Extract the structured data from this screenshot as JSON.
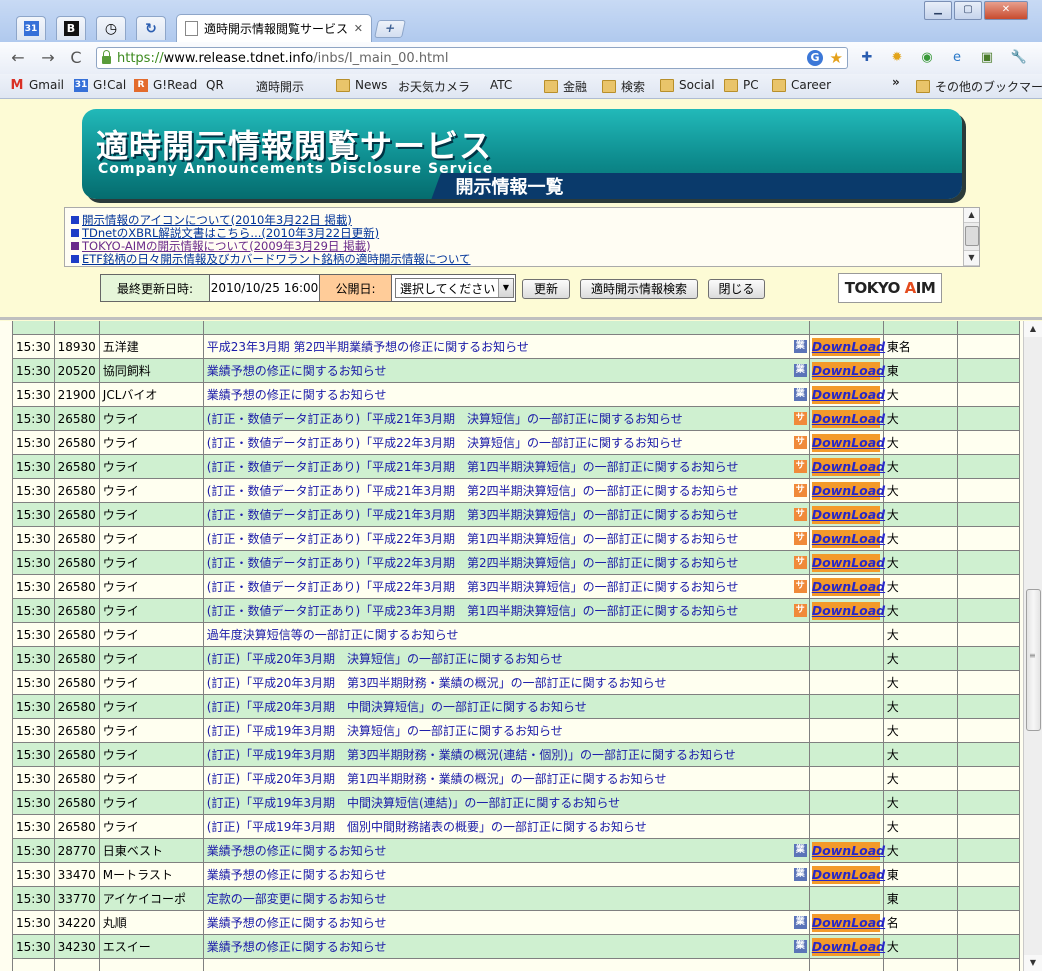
{
  "window": {
    "minimize": "▁",
    "maximize": "▢",
    "close": "✕"
  },
  "tabs": {
    "pinned": [
      {
        "icon": "calendar-icon",
        "glyph": "31"
      },
      {
        "icon": "bookmark-b-icon",
        "glyph": "B"
      },
      {
        "icon": "clock-icon",
        "glyph": "◷"
      },
      {
        "icon": "refresh-icon",
        "glyph": "↻"
      }
    ],
    "active_title": "適時開示情報閲覧サービス ...",
    "new_tab": "+"
  },
  "toolbar": {
    "url_proto": "https://",
    "url_host": "www.release.tdnet.info",
    "url_path": "/inbs/I_main_00.html"
  },
  "bookmarks": [
    {
      "label": "Gmail",
      "icon": "gmail"
    },
    {
      "label": "G!Cal",
      "icon": "cal"
    },
    {
      "label": "G!Read",
      "icon": "read"
    },
    {
      "label": "QR",
      "icon": "page"
    },
    {
      "label": "適時開示",
      "icon": "page"
    },
    {
      "label": "News",
      "icon": "folder"
    },
    {
      "label": "お天気カメラ",
      "icon": "page"
    },
    {
      "label": "ATC",
      "icon": "page"
    },
    {
      "label": "金融",
      "icon": "folder"
    },
    {
      "label": "検索",
      "icon": "folder"
    },
    {
      "label": "Social",
      "icon": "folder"
    },
    {
      "label": "PC",
      "icon": "folder"
    },
    {
      "label": "Career",
      "icon": "folder"
    }
  ],
  "bookmarks_more": "»",
  "bookmarks_other": "その他のブックマーク",
  "banner": {
    "title": "適時開示情報閲覧サービス",
    "subtitle": "Company Announcements Disclosure Service",
    "tag": "開示情報一覧"
  },
  "notices": [
    {
      "text": "開示情報のアイコンについて(2010年3月22日 掲載)",
      "visited": false
    },
    {
      "text": "TDnetのXBRL解説文書はこちら...(2010年3月22日更新)",
      "visited": false
    },
    {
      "text": "TOKYO-AIMの開示情報について(2009年3月29日 掲載)",
      "visited": true
    },
    {
      "text": "ETF銘柄の日々開示情報及びカバードワラント銘柄の適時開示情報について",
      "visited": false
    }
  ],
  "controls": {
    "updated_label": "最終更新日時:",
    "updated_value": "2010/10/25 16:00",
    "publish_label": "公開日:",
    "select_value": "選択してください",
    "refresh": "更新",
    "search": "適時開示情報検索",
    "close": "閉じる",
    "logo_pre": "TOKYO ",
    "logo_a": "A",
    "logo_post": "IM"
  },
  "download_label": "DownLoad",
  "rows": [
    {
      "time": "15:30",
      "code": "18930",
      "name": "五洋建",
      "title": "平成23年3月期 第2四半期業績予想の修正に関するお知らせ",
      "badge": "業",
      "dl": true,
      "ex": "東名"
    },
    {
      "time": "15:30",
      "code": "20520",
      "name": "協同飼料",
      "title": "業績予想の修正に関するお知らせ",
      "badge": "業",
      "dl": true,
      "ex": "東"
    },
    {
      "time": "15:30",
      "code": "21900",
      "name": "JCLバイオ",
      "title": "業績予想の修正に関するお知らせ",
      "badge": "業",
      "dl": true,
      "ex": "大"
    },
    {
      "time": "15:30",
      "code": "26580",
      "name": "ウライ",
      "title": "(訂正・数値データ訂正あり)「平成21年3月期　決算短信」の一部訂正に関するお知らせ",
      "badge": "サ",
      "dl": true,
      "ex": "大"
    },
    {
      "time": "15:30",
      "code": "26580",
      "name": "ウライ",
      "title": "(訂正・数値データ訂正あり)「平成22年3月期　決算短信」の一部訂正に関するお知らせ",
      "badge": "サ",
      "dl": true,
      "ex": "大"
    },
    {
      "time": "15:30",
      "code": "26580",
      "name": "ウライ",
      "title": "(訂正・数値データ訂正あり)「平成21年3月期　第1四半期決算短信」の一部訂正に関するお知らせ",
      "badge": "サ",
      "dl": true,
      "ex": "大"
    },
    {
      "time": "15:30",
      "code": "26580",
      "name": "ウライ",
      "title": "(訂正・数値データ訂正あり)「平成21年3月期　第2四半期決算短信」の一部訂正に関するお知らせ",
      "badge": "サ",
      "dl": true,
      "ex": "大"
    },
    {
      "time": "15:30",
      "code": "26580",
      "name": "ウライ",
      "title": "(訂正・数値データ訂正あり)「平成21年3月期　第3四半期決算短信」の一部訂正に関するお知らせ",
      "badge": "サ",
      "dl": true,
      "ex": "大"
    },
    {
      "time": "15:30",
      "code": "26580",
      "name": "ウライ",
      "title": "(訂正・数値データ訂正あり)「平成22年3月期　第1四半期決算短信」の一部訂正に関するお知らせ",
      "badge": "サ",
      "dl": true,
      "ex": "大"
    },
    {
      "time": "15:30",
      "code": "26580",
      "name": "ウライ",
      "title": "(訂正・数値データ訂正あり)「平成22年3月期　第2四半期決算短信」の一部訂正に関するお知らせ",
      "badge": "サ",
      "dl": true,
      "ex": "大"
    },
    {
      "time": "15:30",
      "code": "26580",
      "name": "ウライ",
      "title": "(訂正・数値データ訂正あり)「平成22年3月期　第3四半期決算短信」の一部訂正に関するお知らせ",
      "badge": "サ",
      "dl": true,
      "ex": "大"
    },
    {
      "time": "15:30",
      "code": "26580",
      "name": "ウライ",
      "title": "(訂正・数値データ訂正あり)「平成23年3月期　第1四半期決算短信」の一部訂正に関するお知らせ",
      "badge": "サ",
      "dl": true,
      "ex": "大"
    },
    {
      "time": "15:30",
      "code": "26580",
      "name": "ウライ",
      "title": "過年度決算短信等の一部訂正に関するお知らせ",
      "badge": "",
      "dl": false,
      "ex": "大"
    },
    {
      "time": "15:30",
      "code": "26580",
      "name": "ウライ",
      "title": "(訂正)「平成20年3月期　決算短信」の一部訂正に関するお知らせ",
      "badge": "",
      "dl": false,
      "ex": "大"
    },
    {
      "time": "15:30",
      "code": "26580",
      "name": "ウライ",
      "title": "(訂正)「平成20年3月期　第3四半期財務・業績の概況」の一部訂正に関するお知らせ",
      "badge": "",
      "dl": false,
      "ex": "大"
    },
    {
      "time": "15:30",
      "code": "26580",
      "name": "ウライ",
      "title": "(訂正)「平成20年3月期　中間決算短信」の一部訂正に関するお知らせ",
      "badge": "",
      "dl": false,
      "ex": "大"
    },
    {
      "time": "15:30",
      "code": "26580",
      "name": "ウライ",
      "title": "(訂正)「平成19年3月期　決算短信」の一部訂正に関するお知らせ",
      "badge": "",
      "dl": false,
      "ex": "大"
    },
    {
      "time": "15:30",
      "code": "26580",
      "name": "ウライ",
      "title": "(訂正)「平成19年3月期　第3四半期財務・業績の概況(連結・個別)」の一部訂正に関するお知らせ",
      "badge": "",
      "dl": false,
      "ex": "大"
    },
    {
      "time": "15:30",
      "code": "26580",
      "name": "ウライ",
      "title": "(訂正)「平成20年3月期　第1四半期財務・業績の概況」の一部訂正に関するお知らせ",
      "badge": "",
      "dl": false,
      "ex": "大"
    },
    {
      "time": "15:30",
      "code": "26580",
      "name": "ウライ",
      "title": "(訂正)「平成19年3月期　中間決算短信(連結)」の一部訂正に関するお知らせ",
      "badge": "",
      "dl": false,
      "ex": "大"
    },
    {
      "time": "15:30",
      "code": "26580",
      "name": "ウライ",
      "title": "(訂正)「平成19年3月期　個別中間財務諸表の概要」の一部訂正に関するお知らせ",
      "badge": "",
      "dl": false,
      "ex": "大"
    },
    {
      "time": "15:30",
      "code": "28770",
      "name": "日東ベスト",
      "title": "業績予想の修正に関するお知らせ",
      "badge": "業",
      "dl": true,
      "ex": "大"
    },
    {
      "time": "15:30",
      "code": "33470",
      "name": "Mートラスト",
      "title": "業績予想の修正に関するお知らせ",
      "badge": "業",
      "dl": true,
      "ex": "東"
    },
    {
      "time": "15:30",
      "code": "33770",
      "name": "アイケイコーポ",
      "title": "定款の一部変更に関するお知らせ",
      "badge": "",
      "dl": false,
      "ex": "東"
    },
    {
      "time": "15:30",
      "code": "34220",
      "name": "丸順",
      "title": "業績予想の修正に関するお知らせ",
      "badge": "業",
      "dl": true,
      "ex": "名"
    },
    {
      "time": "15:30",
      "code": "34230",
      "name": "エスイー",
      "title": "業績予想の修正に関するお知らせ",
      "badge": "業",
      "dl": true,
      "ex": "大"
    }
  ]
}
